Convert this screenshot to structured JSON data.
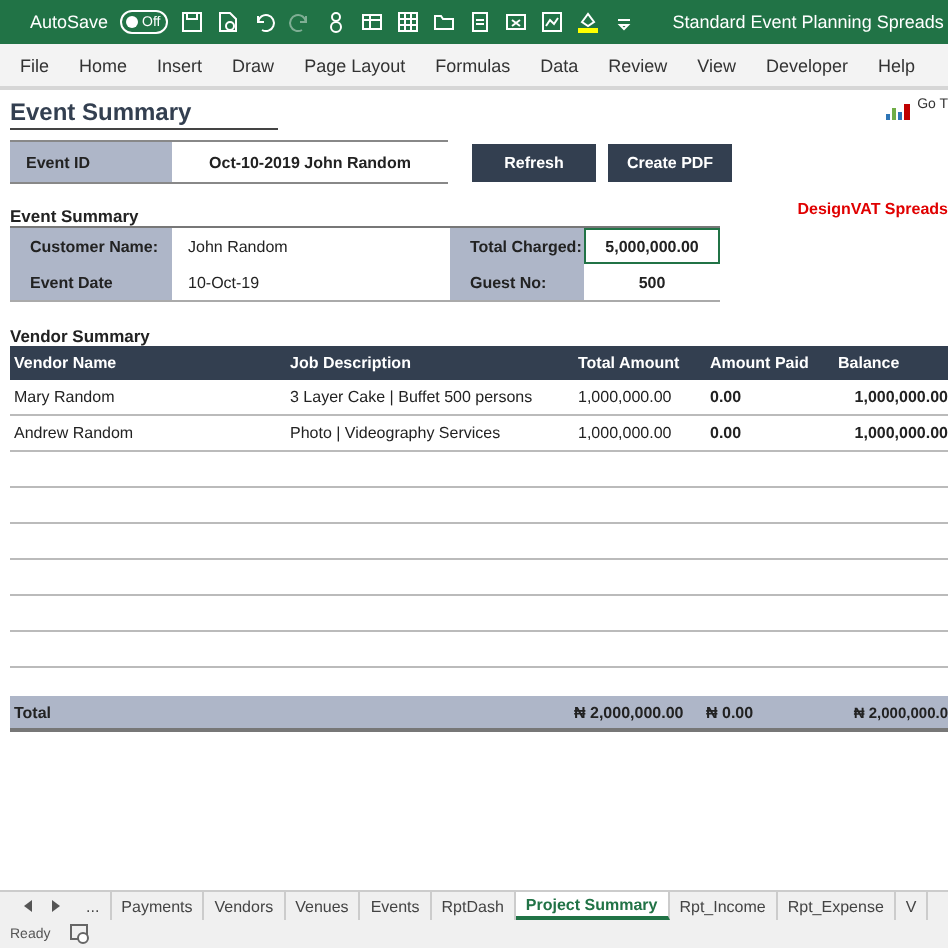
{
  "title_bar": {
    "autosave_label": "AutoSave",
    "autosave": {
      "on": false,
      "label": "Off"
    },
    "title": "Standard Event Planning Spreads"
  },
  "ribbon_tabs": [
    {
      "label": "File"
    },
    {
      "label": "Home"
    },
    {
      "label": "Insert"
    },
    {
      "label": "Draw"
    },
    {
      "label": "Page Layout"
    },
    {
      "label": "Formulas"
    },
    {
      "label": "Data"
    },
    {
      "label": "Review"
    },
    {
      "label": "View"
    },
    {
      "label": "Developer"
    },
    {
      "label": "Help"
    }
  ],
  "sheet": {
    "title": "Event Summary",
    "go_to_link": "Go T",
    "brand": "DesignVAT Spreads",
    "event_id": {
      "label": "Event ID",
      "value": "Oct-10-2019 John Random"
    },
    "buttons": [
      "Refresh",
      "Create PDF"
    ],
    "summary": {
      "heading": "Event Summary",
      "fields": [
        {
          "label": "Customer Name:",
          "value": "John Random",
          "label2": "Total Charged:",
          "value2": "5,000,000.00",
          "selected2": true
        },
        {
          "label": "Event Date",
          "value": "10-Oct-19",
          "label2": "Guest No:",
          "value2": "500",
          "selected2": false
        }
      ]
    },
    "vendors": {
      "heading": "Vendor Summary",
      "columns": [
        "Vendor Name",
        "Job Description",
        "Total Amount",
        "Amount Paid",
        "Balance"
      ],
      "rows": [
        [
          "Mary Random",
          "3 Layer Cake | Buffet 500 persons",
          "1,000,000.00",
          "0.00",
          "1,000,000.00"
        ],
        [
          "Andrew Random",
          "Photo | Videography Services",
          "1,000,000.00",
          "0.00",
          "1,000,000.00"
        ]
      ],
      "total": [
        "Total",
        "₦ 2,000,000.00",
        "₦ 0.00",
        "₦ 2,000,000.0"
      ]
    }
  },
  "sheet_tabs": [
    {
      "label": "...",
      "selected": false
    },
    {
      "label": "Payments",
      "selected": false
    },
    {
      "label": "Vendors",
      "selected": false
    },
    {
      "label": "Venues",
      "selected": false
    },
    {
      "label": "Events",
      "selected": false
    },
    {
      "label": "RptDash",
      "selected": false
    },
    {
      "label": "Project Summary",
      "selected": true
    },
    {
      "label": "Rpt_Income",
      "selected": false
    },
    {
      "label": "Rpt_Expense",
      "selected": false
    },
    {
      "label": "V",
      "selected": false
    }
  ],
  "status_bar": {
    "text": "Ready"
  }
}
